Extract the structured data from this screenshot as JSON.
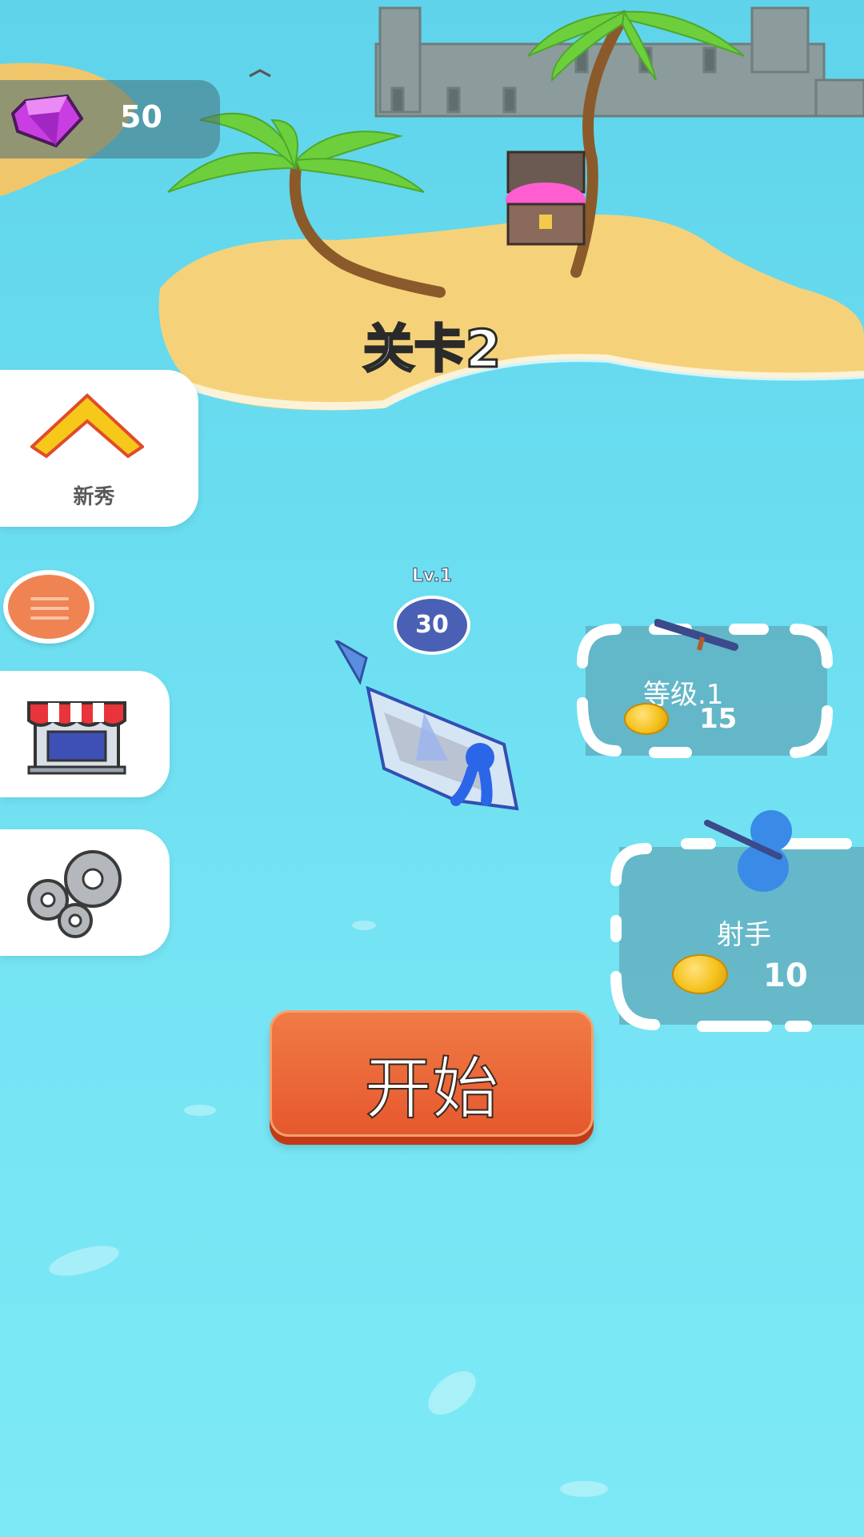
{
  "hud": {
    "gems": "50"
  },
  "level": {
    "label": "关卡2"
  },
  "rank": {
    "label": "新秀"
  },
  "player": {
    "level_label": "Lv.1",
    "power": "30"
  },
  "pads": [
    {
      "label": "等级.1",
      "cost": "15"
    },
    {
      "label": "射手",
      "cost": "10"
    }
  ],
  "start": {
    "label": "开始"
  },
  "colors": {
    "water": "#6ad9ee",
    "start_button": "#e8602f",
    "gem": "#c93ee0",
    "menu": "#f08352"
  }
}
